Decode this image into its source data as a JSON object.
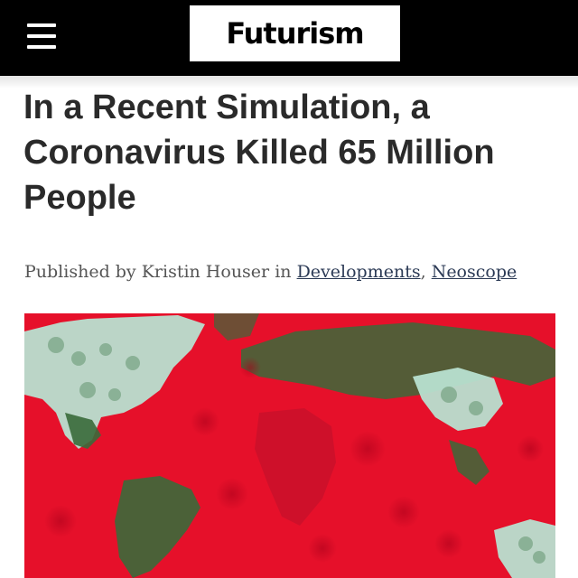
{
  "header": {
    "logo_text": "Futurism",
    "background": "#000000"
  },
  "article": {
    "title": "In a Recent Simulation, a Coronavirus Killed 65 Million People",
    "byline_prefix": "Published by",
    "author": "Kristin Houser",
    "byline_in": "in",
    "categories": [
      "Developments",
      "Neoscope"
    ],
    "separator": ","
  },
  "hero_image": {
    "colors": {
      "infected": "#e6102a",
      "land_green": "#3a6a3a",
      "land_pale": "#b8e0d0"
    }
  }
}
